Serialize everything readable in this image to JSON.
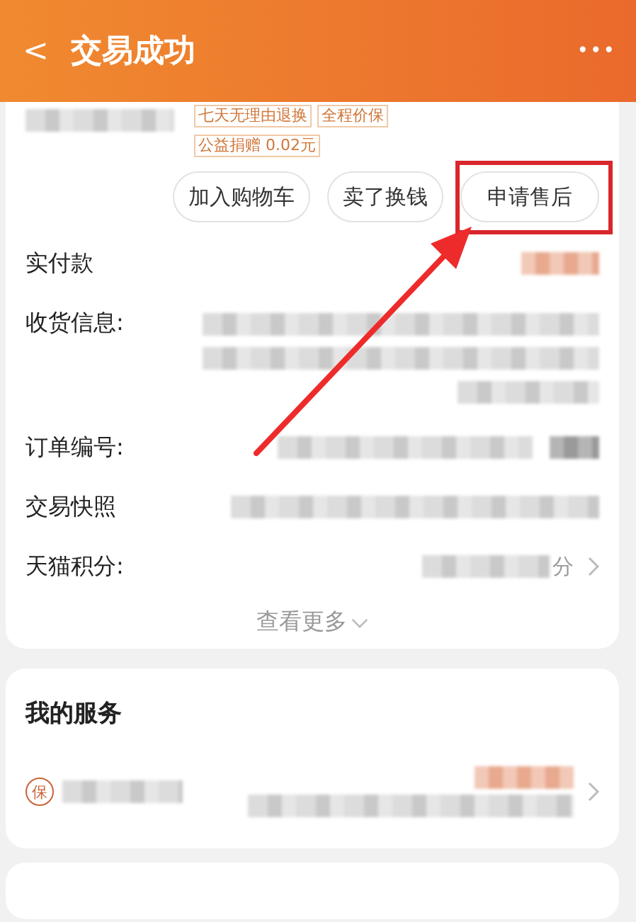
{
  "header": {
    "back": "<",
    "title": "交易成功",
    "more": "•••"
  },
  "product": {
    "tags": [
      {
        "label": "七天无理由退换"
      },
      {
        "label": "全程价保"
      },
      {
        "label": "公益捐赠 0.02元"
      }
    ]
  },
  "actions": [
    {
      "label": "加入购物车",
      "highlighted": false
    },
    {
      "label": "卖了换钱",
      "highlighted": false
    },
    {
      "label": "申请售后",
      "highlighted": true
    }
  ],
  "details": [
    {
      "label": "实付款",
      "kind": "amount"
    },
    {
      "label": "收货信息:",
      "kind": "address"
    },
    {
      "label": "订单编号:",
      "kind": "copy"
    },
    {
      "label": "交易快照",
      "kind": "plain"
    },
    {
      "label": "天猫积分:",
      "kind": "link",
      "suffix": "分"
    }
  ],
  "more": {
    "label": "查看更多"
  },
  "services": {
    "title": "我的服务",
    "items": [
      {
        "badge": "保",
        "kind": "link"
      }
    ]
  }
}
